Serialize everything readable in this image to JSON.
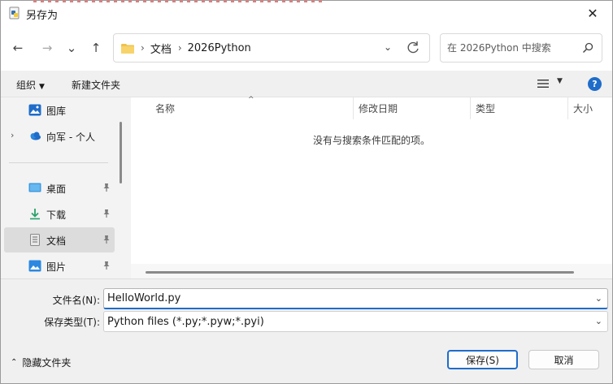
{
  "window": {
    "title": "另存为",
    "close_glyph": "✕"
  },
  "nav": {
    "back_glyph": "←",
    "forward_glyph": "→",
    "recent_glyph": "⌄",
    "up_glyph": "↑",
    "address": {
      "crumbs": [
        "文档",
        "2026Python"
      ],
      "separator": "›",
      "dropdown_glyph": "⌄"
    },
    "search_placeholder": "在 2026Python 中搜索"
  },
  "commandbar": {
    "organize_label": "组织",
    "organize_dd": "▼",
    "new_folder_label": "新建文件夹",
    "view_dd": "▼",
    "help_glyph": "?"
  },
  "sidebar": {
    "items": [
      {
        "label": "图库",
        "icon": "gallery-icon"
      },
      {
        "label": "向军 - 个人",
        "icon": "onedrive-cloud-icon",
        "expander": "›"
      },
      {
        "label": "桌面",
        "icon": "desktop-icon",
        "pinned": true
      },
      {
        "label": "下载",
        "icon": "download-icon",
        "pinned": true
      },
      {
        "label": "文档",
        "icon": "documents-icon",
        "pinned": true,
        "selected": true
      },
      {
        "label": "图片",
        "icon": "pictures-icon",
        "pinned": true
      }
    ]
  },
  "filelist": {
    "columns": [
      "名称",
      "修改日期",
      "类型",
      "大小"
    ],
    "sort_glyph": "^",
    "empty_message": "没有与搜索条件匹配的项。"
  },
  "form": {
    "filename_label": "文件名(N):",
    "filename_value": "HelloWorld.py",
    "filetype_label": "保存类型(T):",
    "filetype_value": "Python files (*.py;*.pyw;*.pyi)",
    "dropdown_glyph": "⌄"
  },
  "footer": {
    "hide_folders_label": "隐藏文件夹",
    "hide_folders_glyph": "⌃",
    "save_label": "保存(S)",
    "cancel_label": "取消"
  },
  "colors": {
    "accent": "#1f6cc9",
    "folder": "#f0c24a"
  }
}
